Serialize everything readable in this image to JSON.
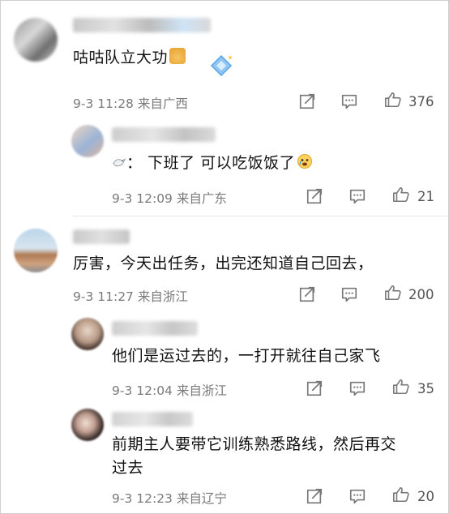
{
  "comments": [
    {
      "text": "咕咕队立大功",
      "date": "9-3 11:28",
      "location": "来自广西",
      "likes": "376",
      "replies": [
        {
          "prefix": "：",
          "text": "下班了  可以吃饭饭了",
          "date": "9-3 12:09",
          "location": "来自广东",
          "likes": "21"
        }
      ]
    },
    {
      "text": "厉害，今天出任务，出完还知道自己回去，",
      "date": "9-3 11:27",
      "location": "来自浙江",
      "likes": "200",
      "replies": [
        {
          "text": "他们是运过去的，一打开就往自己家飞",
          "date": "9-3 12:04",
          "location": "来自浙江",
          "likes": "35"
        },
        {
          "text_line1": "前期主人要带它训练熟悉路线，然后再交",
          "text_line2": "过去",
          "date": "9-3 12:23",
          "location": "来自辽宁",
          "likes": "20"
        }
      ]
    }
  ],
  "icons": {
    "share": "share-icon",
    "comment": "comment-icon",
    "like": "thumbs-up-icon"
  }
}
